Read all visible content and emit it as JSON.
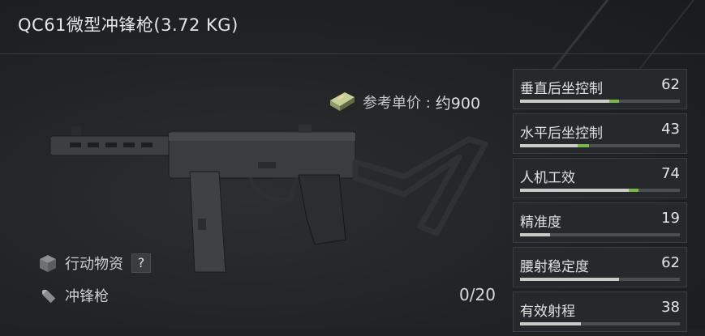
{
  "item": {
    "title": "QC61微型冲锋枪(3.72 KG)"
  },
  "price": {
    "label": "参考单价 :",
    "value": "约900",
    "icon": "cash-stack-icon"
  },
  "meta": {
    "category_label": "行动物资",
    "category_icon": "supply-box-icon",
    "help_badge": "?",
    "type_label": "冲锋枪",
    "type_icon": "bullet-icon"
  },
  "ammo": "0/20",
  "colors": {
    "background": "#1f2122",
    "panel": "#26292b",
    "bar_base": "#c9cbc6",
    "bar_bonus": "#79b84a",
    "track": "#4c4f51"
  },
  "stats": [
    {
      "name": "垂直后坐控制",
      "value": "62",
      "base": 0.56,
      "bonus": 0.06
    },
    {
      "name": "水平后坐控制",
      "value": "43",
      "base": 0.36,
      "bonus": 0.07
    },
    {
      "name": "人机工效",
      "value": "74",
      "base": 0.68,
      "bonus": 0.06
    },
    {
      "name": "精准度",
      "value": "19",
      "base": 0.19,
      "bonus": 0
    },
    {
      "name": "腰射稳定度",
      "value": "62",
      "base": 0.62,
      "bonus": 0
    },
    {
      "name": "有效射程",
      "value": "38",
      "base": 0.38,
      "bonus": 0
    }
  ]
}
